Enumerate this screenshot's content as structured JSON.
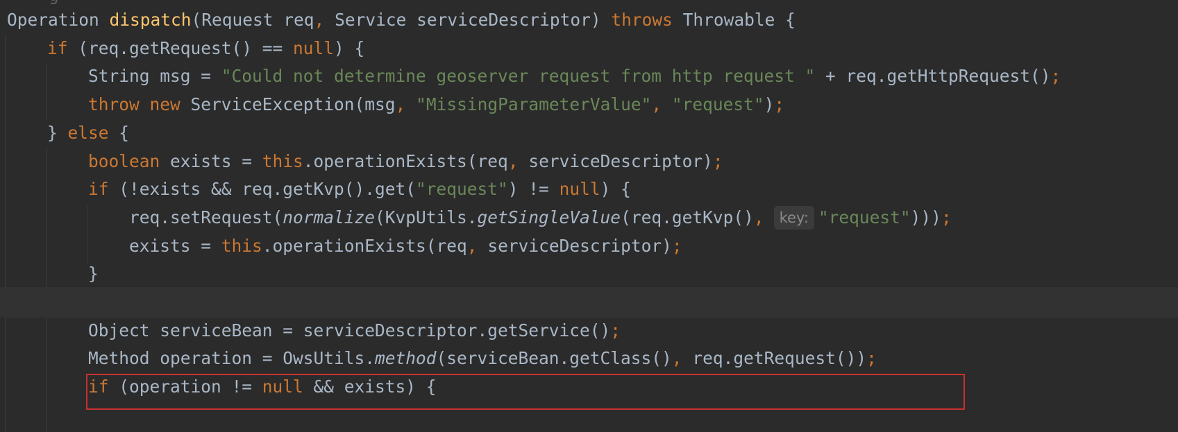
{
  "editor": {
    "top_fragment": "g",
    "colors": {
      "background": "#2b2b2b",
      "caret_row": "#323232",
      "default_text": "#a9b7c6",
      "keyword": "#cc7832",
      "method_declaration": "#ffc66d",
      "string": "#6a8759",
      "inlay_hint_text": "#8a8a8a",
      "highlight_border": "#c8302f"
    },
    "lines": [
      {
        "tokens": [
          {
            "t": "Operation "
          },
          {
            "t": "dispatch",
            "c": "fn"
          },
          {
            "t": "(Request req"
          },
          {
            "t": ", ",
            "c": "punc"
          },
          {
            "t": "Service serviceDescriptor) "
          },
          {
            "t": "throws ",
            "c": "kw"
          },
          {
            "t": "Throwable {"
          }
        ]
      },
      {
        "tokens": [
          {
            "t": "if ",
            "c": "kw"
          },
          {
            "t": "(req.getRequest() == "
          },
          {
            "t": "null",
            "c": "kw"
          },
          {
            "t": ") {"
          }
        ]
      },
      {
        "tokens": [
          {
            "t": "String msg = "
          },
          {
            "t": "\"Could not determine geoserver request from http request \"",
            "c": "str"
          },
          {
            "t": " + req.getHttpRequest()"
          },
          {
            "t": ";",
            "c": "punc"
          }
        ]
      },
      {
        "tokens": [
          {
            "t": "throw ",
            "c": "kw"
          },
          {
            "t": "new ",
            "c": "kw"
          },
          {
            "t": "ServiceException(msg"
          },
          {
            "t": ", ",
            "c": "punc"
          },
          {
            "t": "\"MissingParameterValue\"",
            "c": "str"
          },
          {
            "t": ", ",
            "c": "punc"
          },
          {
            "t": "\"request\"",
            "c": "str"
          },
          {
            "t": ")"
          },
          {
            "t": ";",
            "c": "punc"
          }
        ]
      },
      {
        "tokens": [
          {
            "t": "} "
          },
          {
            "t": "else ",
            "c": "kw"
          },
          {
            "t": "{"
          }
        ]
      },
      {
        "tokens": [
          {
            "t": "boolean ",
            "c": "kw"
          },
          {
            "t": "exists = "
          },
          {
            "t": "this",
            "c": "kw"
          },
          {
            "t": ".operationExists(req"
          },
          {
            "t": ", ",
            "c": "punc"
          },
          {
            "t": "serviceDescriptor)"
          },
          {
            "t": ";",
            "c": "punc"
          }
        ]
      },
      {
        "tokens": [
          {
            "t": "if ",
            "c": "kw"
          },
          {
            "t": "(!exists && req.getKvp().get("
          },
          {
            "t": "\"request\"",
            "c": "str"
          },
          {
            "t": ") != "
          },
          {
            "t": "null",
            "c": "kw"
          },
          {
            "t": ") {"
          }
        ]
      },
      {
        "tokens": [
          {
            "t": "req.setRequest("
          },
          {
            "t": "normalize",
            "c": "it"
          },
          {
            "t": "(KvpUtils."
          },
          {
            "t": "getSingleValue",
            "c": "it"
          },
          {
            "t": "(req.getKvp()"
          },
          {
            "t": ",",
            "c": "punc"
          },
          {
            "t": "key:",
            "c": "hint"
          },
          {
            "t": "\"request\"",
            "c": "str"
          },
          {
            "t": ")))"
          },
          {
            "t": ";",
            "c": "punc"
          }
        ]
      },
      {
        "tokens": [
          {
            "t": "exists = "
          },
          {
            "t": "this",
            "c": "kw"
          },
          {
            "t": ".operationExists(req"
          },
          {
            "t": ", ",
            "c": "punc"
          },
          {
            "t": "serviceDescriptor)"
          },
          {
            "t": ";",
            "c": "punc"
          }
        ]
      },
      {
        "tokens": [
          {
            "t": "}"
          }
        ]
      },
      {
        "tokens": []
      },
      {
        "tokens": [
          {
            "t": "Object serviceBean = serviceDescriptor.getService()"
          },
          {
            "t": ";",
            "c": "punc"
          }
        ]
      },
      {
        "tokens": [
          {
            "t": "Method operation = OwsUtils."
          },
          {
            "t": "method",
            "c": "it"
          },
          {
            "t": "(serviceBean.getClass()"
          },
          {
            "t": ", ",
            "c": "punc"
          },
          {
            "t": "req.getRequest())"
          },
          {
            "t": ";",
            "c": "punc"
          }
        ]
      },
      {
        "tokens": [
          {
            "t": "if ",
            "c": "kw"
          },
          {
            "t": "(operation != "
          },
          {
            "t": "null ",
            "c": "kw"
          },
          {
            "t": "&& exists) {"
          }
        ]
      }
    ]
  }
}
